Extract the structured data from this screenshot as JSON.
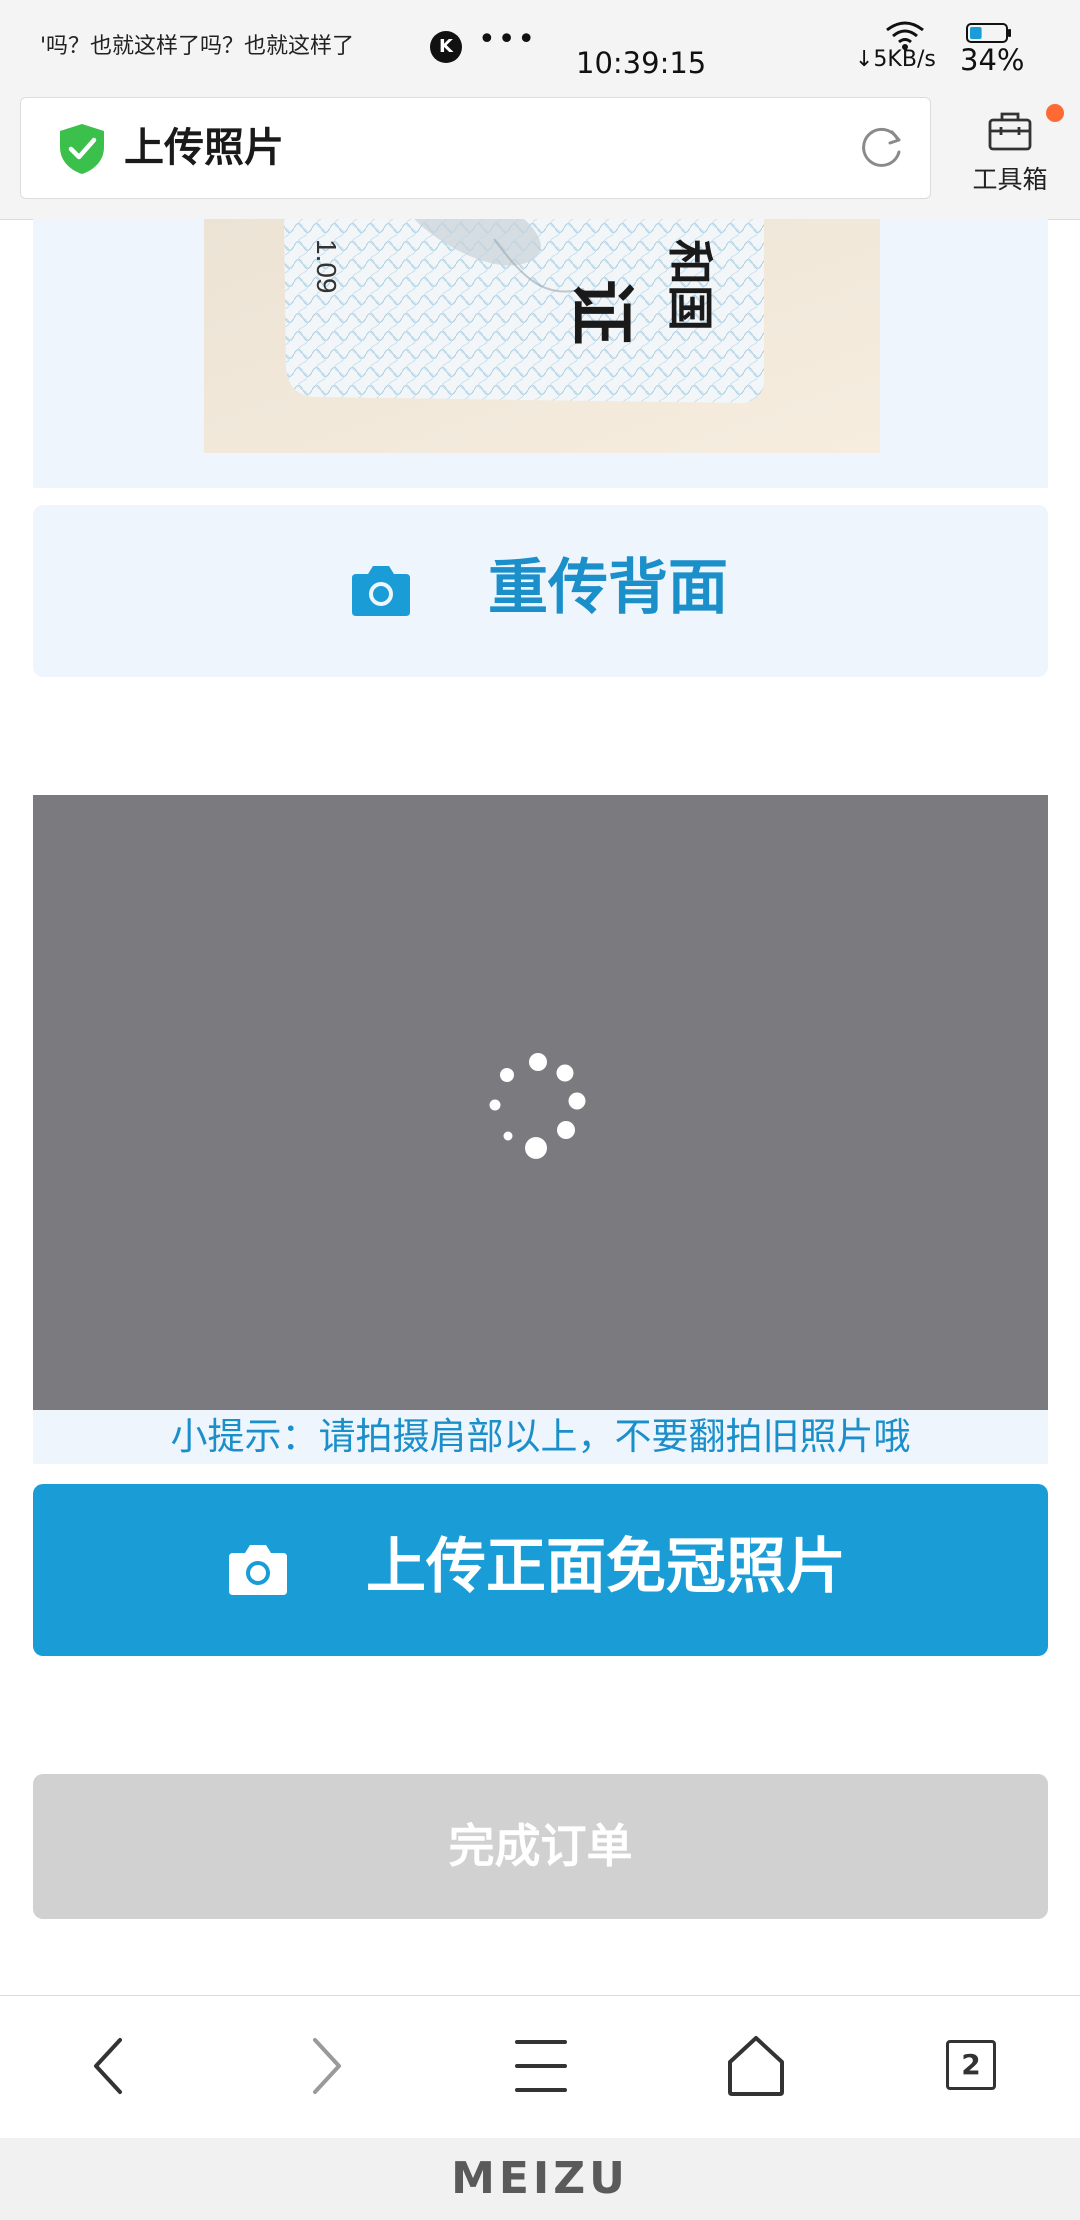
{
  "status_bar": {
    "notification": "'吗？也就这样了吗？也就这样了",
    "k_icon_letter": "K",
    "more": "•••",
    "time": "10:39:15",
    "net_speed": "↓5KB/s",
    "battery": "34%",
    "battery_level": 0.34
  },
  "browser": {
    "page_title": "上传照片",
    "toolbox_label": "工具箱",
    "tab_count": "2"
  },
  "content": {
    "id_card_text": [
      "和国",
      "证"
    ],
    "id_card_digits": "1.09",
    "reupload_back_label": "重传背面",
    "tip_text": "小提示：请拍摄肩部以上，不要翻拍旧照片哦",
    "upload_front_label": "上传正面免冠照片",
    "complete_order_label": "完成订单"
  },
  "brand": {
    "logo": "MEIZU"
  },
  "colors": {
    "accent": "#1a9dd7",
    "accent_text": "#1a8fc9",
    "light_panel": "#eff5fd",
    "preview_bg": "#7b7b7f",
    "disabled_button": "#d1d1d1",
    "shield": "#3cc04c",
    "badge": "#fd6a34"
  }
}
